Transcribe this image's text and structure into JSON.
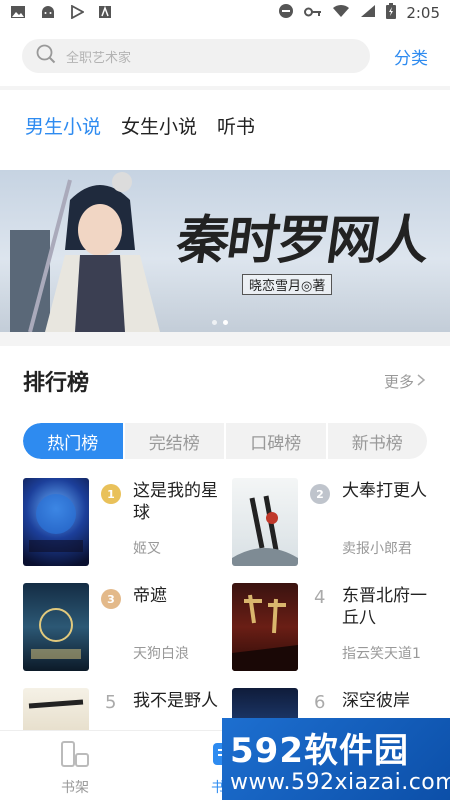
{
  "status_bar": {
    "time": "2:05"
  },
  "search": {
    "placeholder": "全职艺术家",
    "classify_label": "分类"
  },
  "top_tabs": [
    {
      "label": "男生小说",
      "active": true
    },
    {
      "label": "女生小说",
      "active": false
    },
    {
      "label": "听书",
      "active": false
    }
  ],
  "banner": {
    "title": "秦时罗网人",
    "author": "晓恋雪月◎著",
    "page_count": 2,
    "active_page": 2
  },
  "ranking": {
    "title": "排行榜",
    "more_label": "更多",
    "tabs": [
      {
        "label": "热门榜",
        "active": true
      },
      {
        "label": "完结榜",
        "active": false
      },
      {
        "label": "口碑榜",
        "active": false
      },
      {
        "label": "新书榜",
        "active": false
      }
    ],
    "books": [
      {
        "rank": "1",
        "name": "这是我的星球",
        "author": "姬叉",
        "medal_color": "#e9c15a"
      },
      {
        "rank": "2",
        "name": "大奉打更人",
        "author": "卖报小郎君",
        "medal_color": "#bfc4cc"
      },
      {
        "rank": "3",
        "name": "帝遮",
        "author": "天狗白浪",
        "medal_color": "#e3b98a"
      },
      {
        "rank": "4",
        "name": "东晋北府一丘八",
        "author": "指云笑天道1",
        "medal_color": ""
      },
      {
        "rank": "5",
        "name": "我不是野人",
        "author": "",
        "medal_color": ""
      },
      {
        "rank": "6",
        "name": "深空彼岸",
        "author": "",
        "medal_color": ""
      }
    ]
  },
  "bottom_nav": [
    {
      "label": "书架",
      "icon": "bookshelf-icon",
      "active": false
    },
    {
      "label": "书库",
      "icon": "library-icon",
      "active": true
    }
  ],
  "watermark": {
    "line1": "592软件园",
    "line2": "www.592xiazai.com"
  },
  "colors": {
    "accent": "#2e8bf0"
  }
}
